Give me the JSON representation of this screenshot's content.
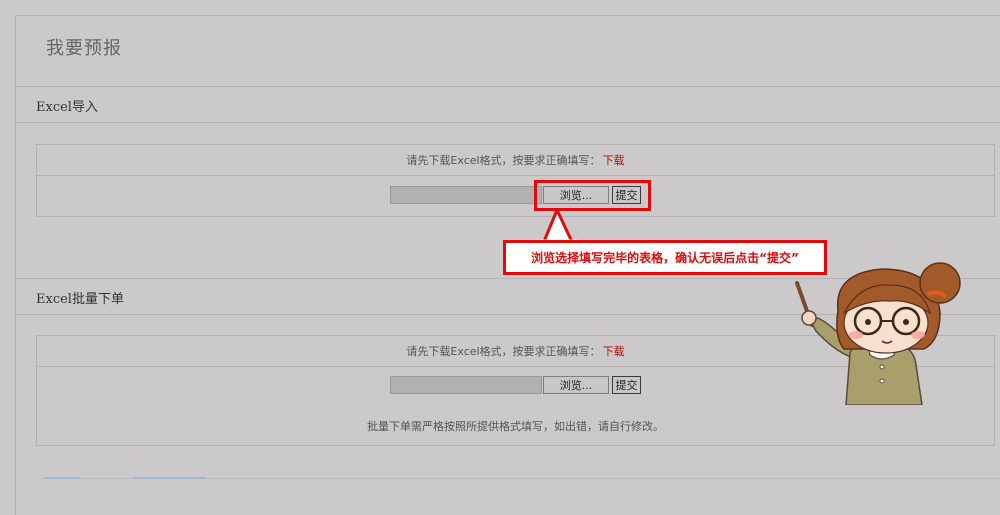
{
  "page": {
    "title": "我要预报"
  },
  "excel_import": {
    "section_title": "Excel导入",
    "hint_prefix": "请先下载Excel格式，按要求正确填写：",
    "download_link": "下载",
    "browse_label": "浏览...",
    "submit_label": "提交"
  },
  "callout": {
    "text": "浏览选择填写完毕的表格，确认无误后点击“提交”",
    "color": "#e20a0a"
  },
  "excel_batch": {
    "section_title": "Excel批量下单",
    "hint_prefix": "请先下载Excel格式，按要求正确填写：",
    "download_link": "下载",
    "browse_label": "浏览...",
    "submit_label": "提交",
    "note": "批量下单需严格按照所提供格式填写，如出错，请自行修改。"
  },
  "illustration": {
    "icon": "girl-with-pointer-illustration"
  }
}
